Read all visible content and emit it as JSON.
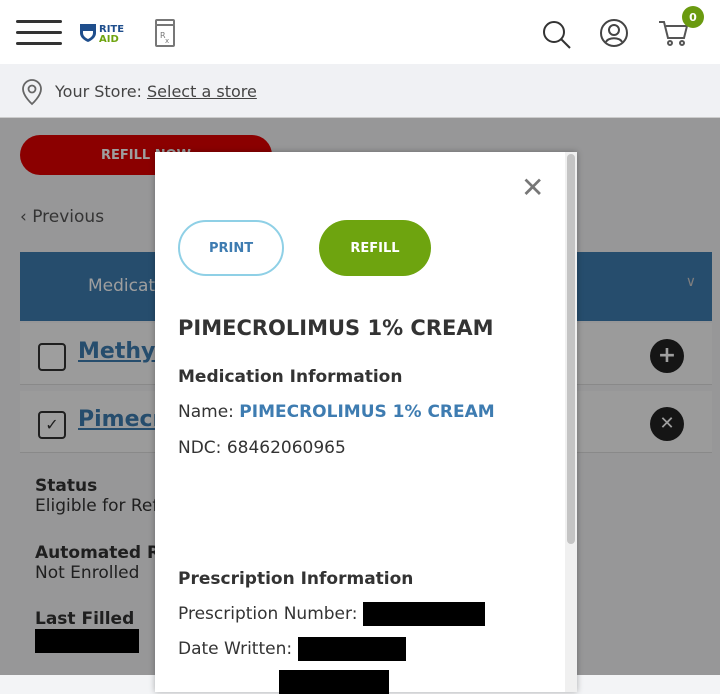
{
  "header": {
    "logo_text": [
      "RITE",
      "AID"
    ],
    "cart_count": "0"
  },
  "store": {
    "label": "Your Store:",
    "link": "Select a store"
  },
  "page": {
    "refill_now": "REFILL NOW",
    "previous": "Previous",
    "med_header": "Medications",
    "rows": [
      {
        "name": "Methylprednisolone",
        "checked": false,
        "action": "add"
      },
      {
        "name": "Pimecrolimus",
        "checked": true,
        "action": "remove"
      }
    ],
    "details": [
      {
        "label": "Status",
        "value": "Eligible for Refill"
      },
      {
        "label": "Automated Refill",
        "value": "Not Enrolled"
      },
      {
        "label": "Last Filled",
        "value": ""
      }
    ]
  },
  "modal": {
    "print": "PRINT",
    "refill": "REFILL",
    "title": "PIMECROLIMUS 1% CREAM",
    "med_info_heading": "Medication Information",
    "name_label": "Name:",
    "name_value": "PIMECROLIMUS 1% CREAM",
    "ndc_label": "NDC:",
    "ndc_value": "68462060965",
    "rx_info_heading": "Prescription Information",
    "rx_number_label": "Prescription Number:",
    "date_written_label": "Date Written:"
  },
  "colors": {
    "brand_red": "#e00000",
    "accent_blue": "#3e7cb1",
    "refill_green": "#6ea40f"
  }
}
